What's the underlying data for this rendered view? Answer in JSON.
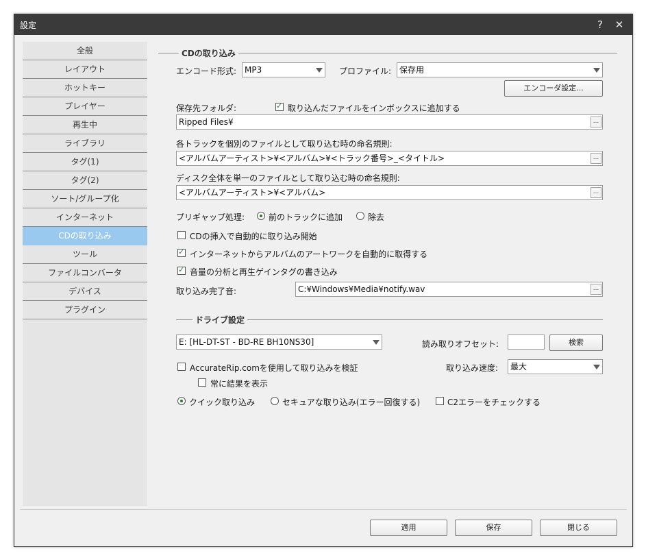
{
  "window": {
    "title": "設定",
    "help_icon": "?",
    "close_icon": "✕"
  },
  "sidebar": {
    "items": [
      {
        "label": "全般"
      },
      {
        "label": "レイアウト"
      },
      {
        "label": "ホットキー"
      },
      {
        "label": "プレイヤー"
      },
      {
        "label": "再生中"
      },
      {
        "label": "ライブラリ"
      },
      {
        "label": "タグ(1)"
      },
      {
        "label": "タグ(2)"
      },
      {
        "label": "ソート/グループ化"
      },
      {
        "label": "インターネット"
      },
      {
        "label": "CDの取り込み",
        "selected": true
      },
      {
        "label": "ツール"
      },
      {
        "label": "ファイルコンバータ"
      },
      {
        "label": "デバイス"
      },
      {
        "label": "プラグイン"
      }
    ]
  },
  "rip": {
    "group_title": "CDの取り込み",
    "encode_label": "エンコード形式:",
    "encode_value": "MP3",
    "profile_label": "プロファイル:",
    "profile_value": "保存用",
    "encoder_settings_button": "エンコーダ設定...",
    "save_folder_label": "保存先フォルダ:",
    "add_to_inbox_label": "取り込んだファイルをインボックスに追加する",
    "add_to_inbox_checked": true,
    "save_folder_value": "Ripped Files¥",
    "track_naming_label": "各トラックを個別のファイルとして取り込む時の命名規則:",
    "track_naming_value": "<アルバムアーティスト>¥<アルバム>¥<トラック番号>_<タイトル>",
    "disc_naming_label": "ディスク全体を単一のファイルとして取り込む時の命名規則:",
    "disc_naming_value": "<アルバムアーティスト>¥<アルバム>",
    "pregap_label": "プリギャップ処理:",
    "pregap_add_label": "前のトラックに追加",
    "pregap_remove_label": "除去",
    "pregap_selected": "add",
    "auto_start_label": "CDの挿入で自動的に取り込み開始",
    "auto_start_checked": false,
    "artwork_label": "インターネットからアルバムのアートワークを自動的に取得する",
    "artwork_checked": true,
    "replaygain_label": "音量の分析と再生ゲインタグの書き込み",
    "replaygain_checked": true,
    "complete_sound_label": "取り込み完了音:",
    "complete_sound_value": "C:¥Windows¥Media¥notify.wav",
    "browse_glyph": "..."
  },
  "drive": {
    "group_title": "ドライブ設定",
    "drive_value": "E: [HL-DT-ST - BD-RE  BH10NS30]",
    "offset_label": "読み取りオフセット:",
    "offset_value": "",
    "detect_button": "検索",
    "accuraterip_label": "AccurateRip.comを使用して取り込みを検証",
    "accuraterip_checked": false,
    "always_show_label": "常に結果を表示",
    "always_show_checked": false,
    "speed_label": "取り込み速度:",
    "speed_value": "最大",
    "quick_rip_label": "クイック取り込み",
    "secure_rip_label": "セキュアな取り込み(エラー回復する)",
    "rip_mode_selected": "quick",
    "c2_label": "C2エラーをチェックする",
    "c2_checked": false
  },
  "footer": {
    "apply": "適用",
    "save": "保存",
    "close": "閉じる"
  }
}
